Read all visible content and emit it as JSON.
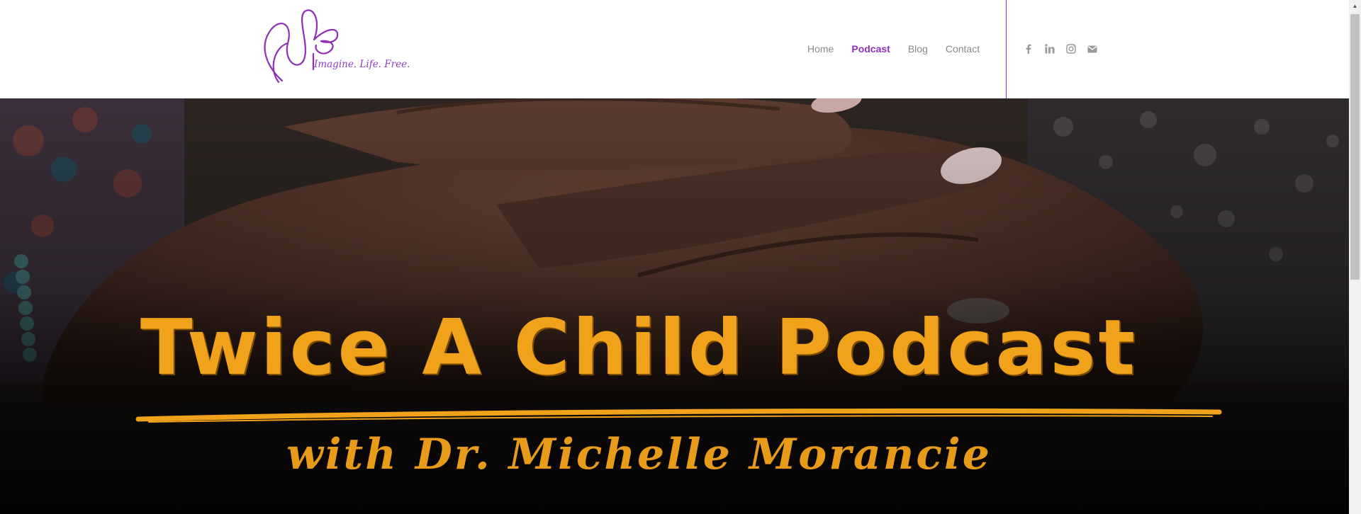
{
  "header": {
    "logo": {
      "tagline": "Imagine. Life. Free.",
      "brand_color": "#8f2fb8"
    },
    "nav": [
      {
        "label": "Home",
        "active": false
      },
      {
        "label": "Podcast",
        "active": true
      },
      {
        "label": "Blog",
        "active": false
      },
      {
        "label": "Contact",
        "active": false
      }
    ],
    "social_icons": [
      "facebook-icon",
      "linkedin-icon",
      "instagram-icon",
      "mail-icon"
    ]
  },
  "hero": {
    "title": "Twice A Child Podcast",
    "subtitle": "with Dr. Michelle Morancie",
    "title_color": "#f0a21b"
  }
}
